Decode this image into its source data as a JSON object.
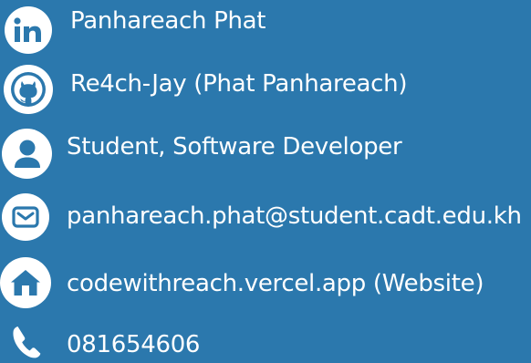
{
  "colors": {
    "background": "#2b78ad",
    "icon_bg": "#ffffff",
    "text": "#ffffff"
  },
  "contacts": [
    {
      "icon": "linkedin-icon",
      "text": "Panhareach Phat"
    },
    {
      "icon": "github-icon",
      "text": "Re4ch-Jay (Phat Panhareach)"
    },
    {
      "icon": "person-icon",
      "text": "Student, Software Developer"
    },
    {
      "icon": "mail-icon",
      "text": "panhareach.phat@student.cadt.edu.kh"
    },
    {
      "icon": "home-icon",
      "text": "codewithreach.vercel.app (Website)"
    },
    {
      "icon": "phone-icon",
      "text": "081654606"
    }
  ]
}
